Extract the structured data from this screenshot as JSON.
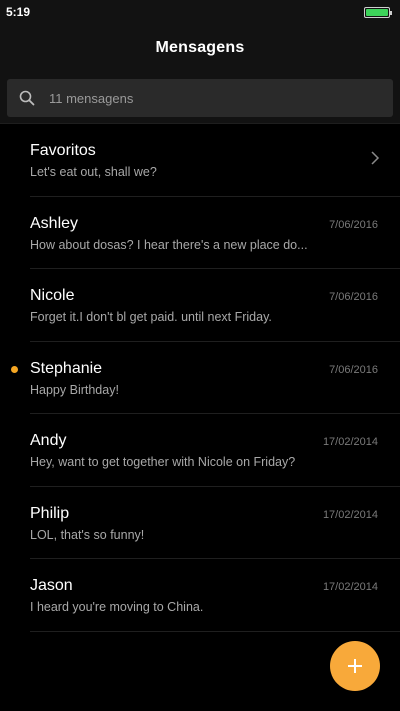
{
  "status": {
    "time": "5:19",
    "battery_level": 1.0
  },
  "header": {
    "title": "Mensagens"
  },
  "search": {
    "placeholder": "11 mensagens"
  },
  "favorites": {
    "name": "Favoritos",
    "preview": "Let's eat out, shall we?"
  },
  "messages": [
    {
      "name": "Ashley",
      "preview": "How about dosas? I hear there's a new place do...",
      "date": "7/06/2016",
      "unread": false
    },
    {
      "name": "Nicole",
      "preview": "Forget it.I don't bl get paid. until next Friday.",
      "date": "7/06/2016",
      "unread": false
    },
    {
      "name": "Stephanie",
      "preview": "Happy Birthday!",
      "date": "7/06/2016",
      "unread": true
    },
    {
      "name": "Andy",
      "preview": "Hey, want to get together with Nicole on Friday?",
      "date": "17/02/2014",
      "unread": false
    },
    {
      "name": "Philip",
      "preview": "LOL, that's so funny!",
      "date": "17/02/2014",
      "unread": false
    },
    {
      "name": "Jason",
      "preview": "I heard you're moving to China.",
      "date": "17/02/2014",
      "unread": false
    }
  ],
  "colors": {
    "accent": "#f8a93a",
    "unread_dot": "#f5a623",
    "background": "#000000"
  },
  "icons": {
    "search": "search-icon",
    "chevron": "chevron-right-icon",
    "fab": "plus-icon"
  }
}
